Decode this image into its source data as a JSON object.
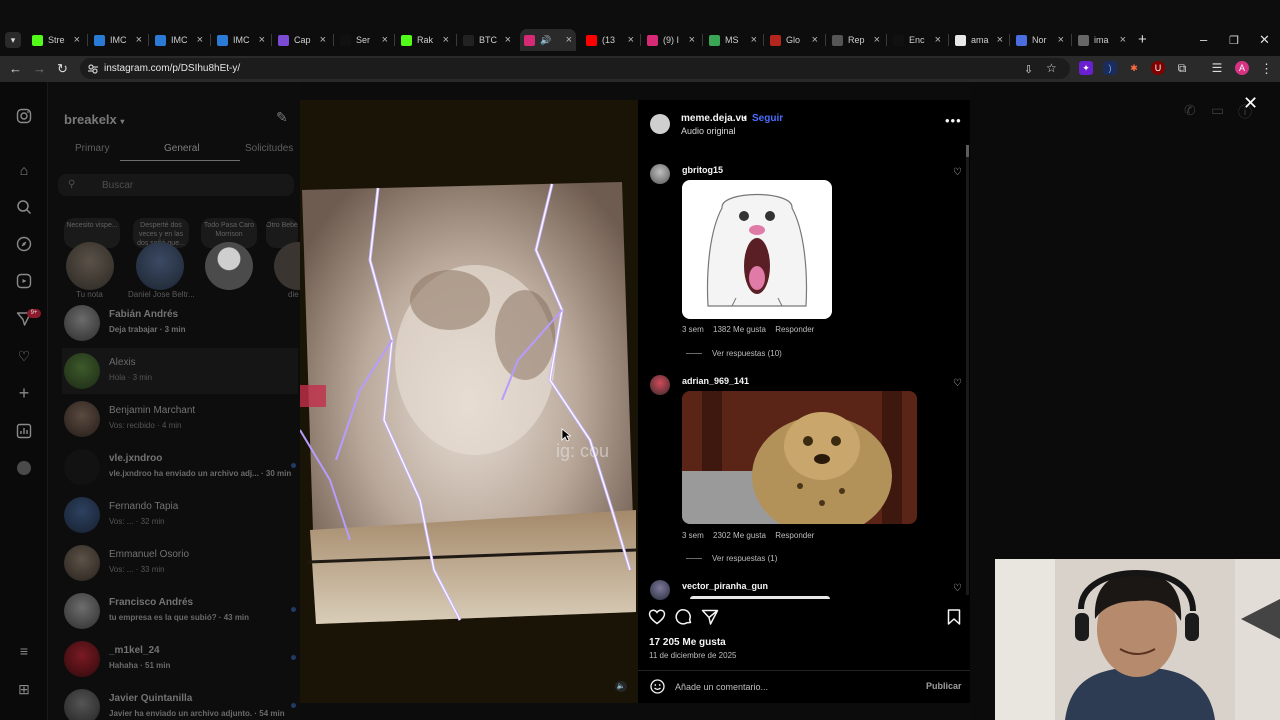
{
  "browser": {
    "tabs": [
      {
        "label": "Stre",
        "color": "#53fc18"
      },
      {
        "label": "IMC",
        "color": "#2b7bd6"
      },
      {
        "label": "IMC",
        "color": "#2b7bd6"
      },
      {
        "label": "IMC",
        "color": "#2b7bd6"
      },
      {
        "label": "Cap",
        "color": "#7b4bd6"
      },
      {
        "label": "Ser",
        "color": "#111111"
      },
      {
        "label": "Rak",
        "color": "#53fc18"
      },
      {
        "label": "BTC",
        "color": "#222222"
      },
      {
        "label": "",
        "color": "#d62976"
      },
      {
        "label": "(13",
        "color": "#ff0000"
      },
      {
        "label": "(9) I",
        "color": "#d62976"
      },
      {
        "label": "MS",
        "color": "#3aa655"
      },
      {
        "label": "Glo",
        "color": "#b3261e"
      },
      {
        "label": "Rep",
        "color": "#555555"
      },
      {
        "label": "Enc",
        "color": "#111111"
      },
      {
        "label": "ama",
        "color": "#e8e8e8"
      },
      {
        "label": "Nor",
        "color": "#4a6ee0"
      },
      {
        "label": "ima",
        "color": "#666666"
      }
    ],
    "url": "instagram.com/p/DSIhu8hEt-y/",
    "profile_initial": "A"
  },
  "sidebar": {
    "account": "breakelx",
    "tabs": [
      "Primary",
      "General",
      "Solicitudes"
    ],
    "search_placeholder": "Buscar",
    "badge": "9+",
    "notes": [
      "Necesito vispe...",
      "Desperté dos veces y en las dos soñé que...",
      "Todo Pasa Caro Morrison",
      "Otro Bebé"
    ],
    "story_labels": [
      "Tu nota",
      "Daniel Jose Beltr...",
      "",
      "die"
    ],
    "chats": [
      {
        "name": "Fabián Andrés",
        "preview": "Deja trabajar · 3 min"
      },
      {
        "name": "Alexis",
        "preview": "Hola · 3 min"
      },
      {
        "name": "Benjamin Marchant",
        "preview": "Vos: recibido · 4 min"
      },
      {
        "name": "vle.jxndroo",
        "preview": "vle.jxndroo ha enviado un archivo adj... · 30 min"
      },
      {
        "name": "Fernando Tapia",
        "preview": "Vos: ... · 32 min"
      },
      {
        "name": "Emmanuel Osorio",
        "preview": "Vos: ... · 33 min"
      },
      {
        "name": "Francisco Andrés",
        "preview": "tu empresa es la que subió? · 43 min"
      },
      {
        "name": "_m1kel_24",
        "preview": "Hahaha · 51 min"
      },
      {
        "name": "Javier Quintanilla",
        "preview": "Javier ha enviado un archivo adjunto. · 54 min"
      }
    ]
  },
  "media": {
    "watermark": "ig: cou"
  },
  "post": {
    "username": "meme.deja.vu",
    "dot": "•",
    "follow": "Seguir",
    "audio": "Audio original",
    "comments": [
      {
        "user": "gbritog15",
        "time": "3 sem",
        "likes": "1382 Me gusta",
        "reply": "Responder",
        "replies": "Ver respuestas (10)"
      },
      {
        "user": "adrian_969_141",
        "time": "3 sem",
        "likes": "2302 Me gusta",
        "reply": "Responder",
        "replies": "Ver respuestas (1)"
      },
      {
        "user": "vector_piranha_gun",
        "time": "",
        "likes": "",
        "reply": "",
        "replies": ""
      }
    ],
    "like_count": "17 205 Me gusta",
    "date": "11 de diciembre de 2025",
    "comment_placeholder": "Añade un comentario...",
    "publish": "Publicar"
  }
}
